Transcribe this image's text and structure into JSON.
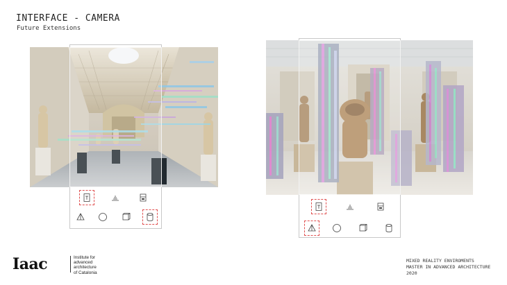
{
  "header": {
    "title": "INTERFACE - CAMERA",
    "subtitle": "Future Extensions"
  },
  "panels": [
    {
      "name": "hall-view",
      "toolbar_row1": [
        "text-tool-icon",
        "draw-tool-icon",
        "print-tool-icon"
      ],
      "toolbar_row2": [
        "pyramid-shape-icon",
        "sphere-shape-icon",
        "cube-shape-icon",
        "cylinder-shape-icon"
      ],
      "selected_row1": 0,
      "selected_row2": 3
    },
    {
      "name": "statue-view",
      "toolbar_row1": [
        "text-tool-icon",
        "draw-tool-icon",
        "print-tool-icon"
      ],
      "toolbar_row2": [
        "pyramid-shape-icon",
        "sphere-shape-icon",
        "cube-shape-icon",
        "cylinder-shape-icon"
      ],
      "selected_row1": 0,
      "selected_row2": 0
    }
  ],
  "footer": {
    "logo_text": "Iaac",
    "institute_lines": [
      "Institute for",
      "advanced",
      "architecture",
      "of Catalonia"
    ],
    "credit_lines": [
      "MIXED REALITY ENVIROMENTS",
      "MASTER IN ADVANCED ARCHITECTURE",
      "2020"
    ]
  },
  "colors": {
    "selection": "#e05050",
    "frame": "#c8c8c8"
  }
}
